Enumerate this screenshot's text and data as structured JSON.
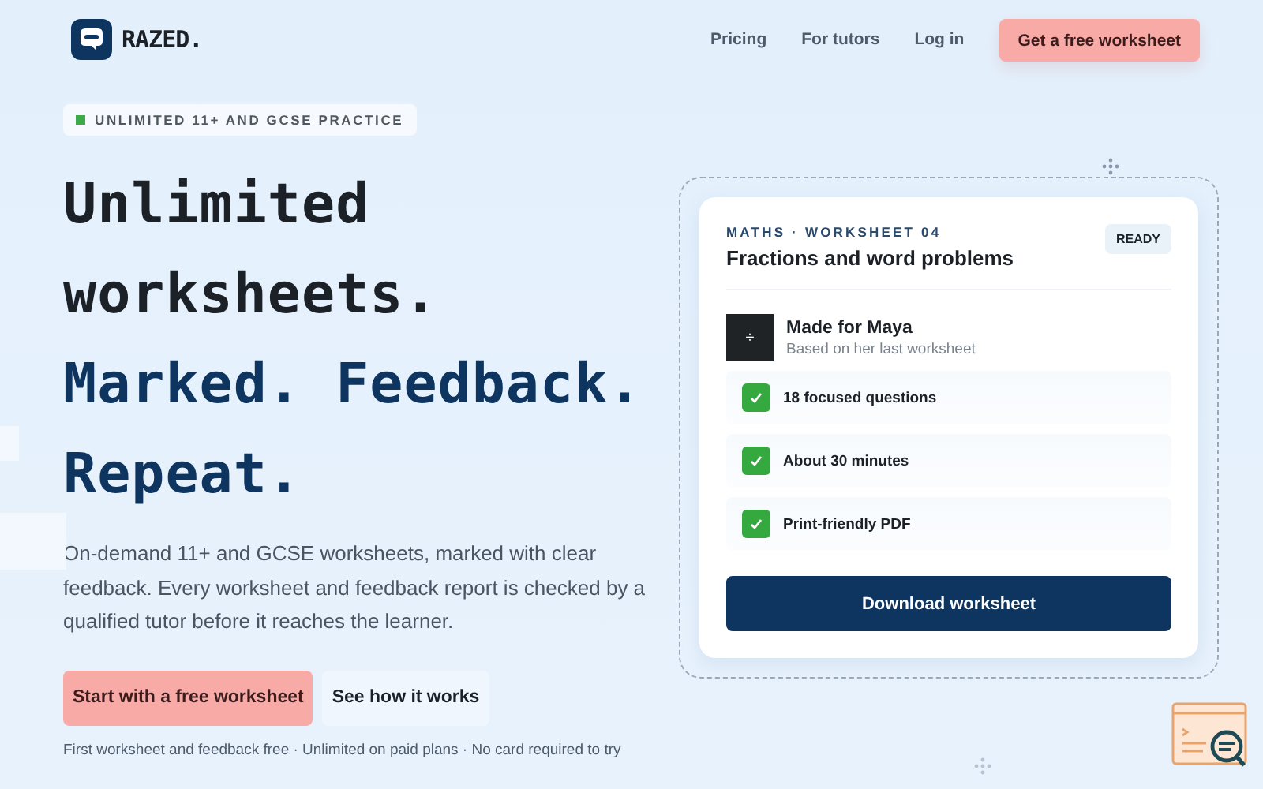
{
  "brand": {
    "name": "RAZED."
  },
  "nav": {
    "links": [
      "Pricing",
      "For tutors",
      "Log in"
    ],
    "cta": "Get a free worksheet"
  },
  "badge": {
    "text": "UNLIMITED 11+ AND GCSE PRACTICE",
    "color": "#3daa4a"
  },
  "headline": [
    {
      "text": "Unlimited",
      "color": "#1c2128"
    },
    {
      "text": "worksheets.",
      "color": "#1c2128"
    },
    {
      "text": "Marked. Feedback.",
      "color": "#0d3560"
    },
    {
      "text": "Repeat.",
      "color": "#0d3560"
    }
  ],
  "intro": "On-demand 11+ and GCSE worksheets, marked with clear feedback. Every worksheet and feedback report is checked by a qualified tutor before it reaches the learner.",
  "actions": [
    {
      "label": "Start with a free worksheet",
      "kind": "primary"
    },
    {
      "label": "See how it works",
      "kind": "secondary"
    }
  ],
  "footnote": "First worksheet and feedback free · Unlimited on paid plans · No card required to try",
  "card": {
    "eyebrow": "MATHS · WORKSHEET 04",
    "title": "Fractions and word problems",
    "status": "READY",
    "learner": {
      "icon": "÷",
      "name": "Made for Maya",
      "note": "Based on her last worksheet"
    },
    "features": [
      {
        "text": "18 focused questions",
        "checked": true
      },
      {
        "text": "About 30 minutes",
        "checked": true
      },
      {
        "text": "Print-friendly PDF",
        "checked": true
      }
    ],
    "button": "Download worksheet"
  }
}
